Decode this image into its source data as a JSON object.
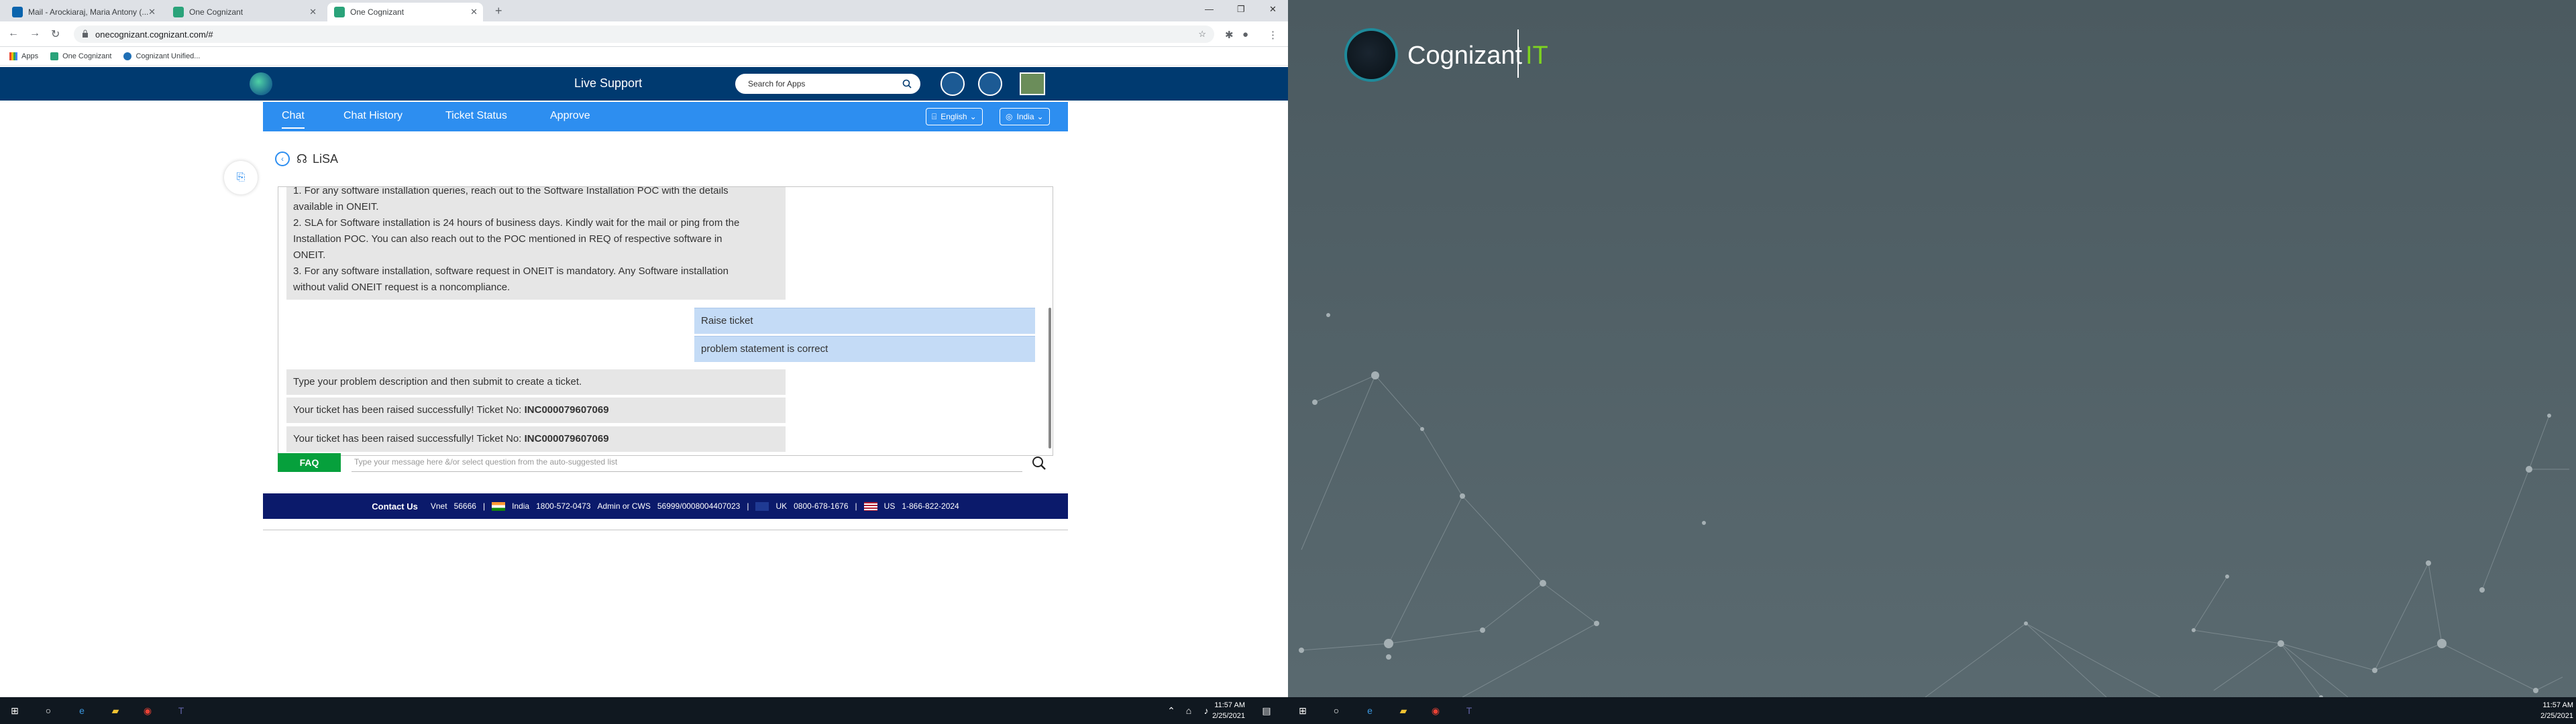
{
  "browser": {
    "tabs": [
      {
        "title": "Mail - Arockiaraj, Maria Antony (..."
      },
      {
        "title": "One Cognizant"
      },
      {
        "title": "One Cognizant"
      }
    ],
    "url": "onecognizant.cognizant.com/#",
    "bookmarks": [
      "Apps",
      "One Cognizant",
      "Cognizant Unified..."
    ]
  },
  "site": {
    "title": "Live Support",
    "search_placeholder": "Search for Apps",
    "nav": [
      "Chat",
      "Chat History",
      "Ticket Status",
      "Approve"
    ],
    "language": "English",
    "country": "India"
  },
  "lisa": {
    "title": "LiSA",
    "messages": [
      {
        "from": "bot",
        "lines": [
          "1. For any software installation queries, reach out to the Software Installation POC with the details",
          "available in ONEIT.",
          "2. SLA for Software installation is 24 hours of business days. Kindly wait for the mail or ping from the",
          "Installation POC. You can also reach out to the POC mentioned in REQ of respective software in",
          "ONEIT.",
          "3. For any software installation, software request in ONEIT is mandatory. Any Software installation",
          "without valid ONEIT request is a noncompliance."
        ]
      },
      {
        "from": "user",
        "text": "Raise ticket"
      },
      {
        "from": "user",
        "text": "problem statement is correct"
      },
      {
        "from": "bot",
        "text": "Type your problem description and then submit to create a ticket."
      },
      {
        "from": "bot",
        "text": "Your ticket has been raised successfully! Ticket No:",
        "ticket": "INC000079607069"
      },
      {
        "from": "bot",
        "text": "Your ticket has been raised successfully! Ticket No:",
        "ticket": "INC000079607069"
      }
    ],
    "faq_label": "FAQ",
    "input_placeholder": "Type your message here &/or select question from the auto-suggested list"
  },
  "footer": {
    "contact": "Contact Us",
    "vnet_label": "Vnet",
    "vnet": "56666",
    "india_label": "India",
    "india": "1800-572-0473",
    "admin_label": "Admin or CWS",
    "admin": "56999/0008004407023",
    "uk_label": "UK",
    "uk": "0800-678-1676",
    "us_label": "US",
    "us": "1-866-822-2024"
  },
  "wallpaper": {
    "brand": "Cognizant",
    "brand_suffix": "IT"
  },
  "taskbar": {
    "time": "11:57 AM",
    "date": "2/25/2021"
  },
  "colors": {
    "header": "#003a70",
    "nav": "#2d8ef0",
    "faq": "#06a03c",
    "footer": "#0b1a6b",
    "user_bubble": "#c4dbf6",
    "bot_bubble": "#e6e6e6"
  }
}
